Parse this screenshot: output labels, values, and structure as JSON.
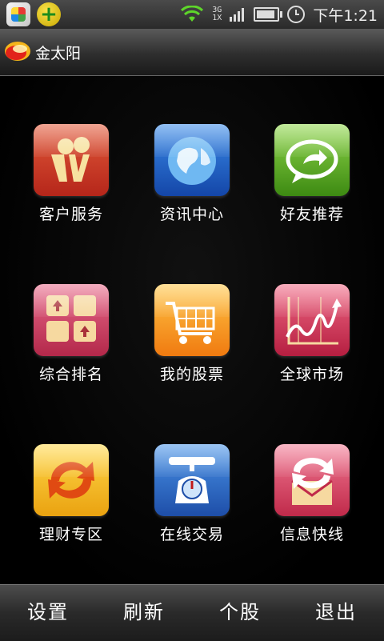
{
  "status_bar": {
    "network": [
      "3G",
      "1X"
    ],
    "time": "下午1:21",
    "icons": [
      "app-launcher-icon",
      "add-app-icon",
      "wifi-icon",
      "signal-icon",
      "battery-icon",
      "alarm-icon"
    ]
  },
  "header": {
    "title": "金太阳",
    "logo": "sun-logo"
  },
  "grid": {
    "items": [
      {
        "label": "客户服务",
        "icon": "customer-service-icon",
        "color": "#c83a22"
      },
      {
        "label": "资讯中心",
        "icon": "globe-icon",
        "color": "#2466c8"
      },
      {
        "label": "好友推荐",
        "icon": "share-chat-icon",
        "color": "#5fb02a"
      },
      {
        "label": "综合排名",
        "icon": "ranking-icon",
        "color": "#c8405e"
      },
      {
        "label": "我的股票",
        "icon": "shopping-cart-icon",
        "color": "#f59a22"
      },
      {
        "label": "全球市场",
        "icon": "market-chart-icon",
        "color": "#d03a5a"
      },
      {
        "label": "理财专区",
        "icon": "exchange-arrows-icon",
        "color": "#f2b624"
      },
      {
        "label": "在线交易",
        "icon": "scale-icon",
        "color": "#2e6ec8"
      },
      {
        "label": "信息快线",
        "icon": "mail-refresh-icon",
        "color": "#d83e5c"
      }
    ]
  },
  "bottom_bar": {
    "items": [
      "设置",
      "刷新",
      "个股",
      "退出"
    ]
  }
}
